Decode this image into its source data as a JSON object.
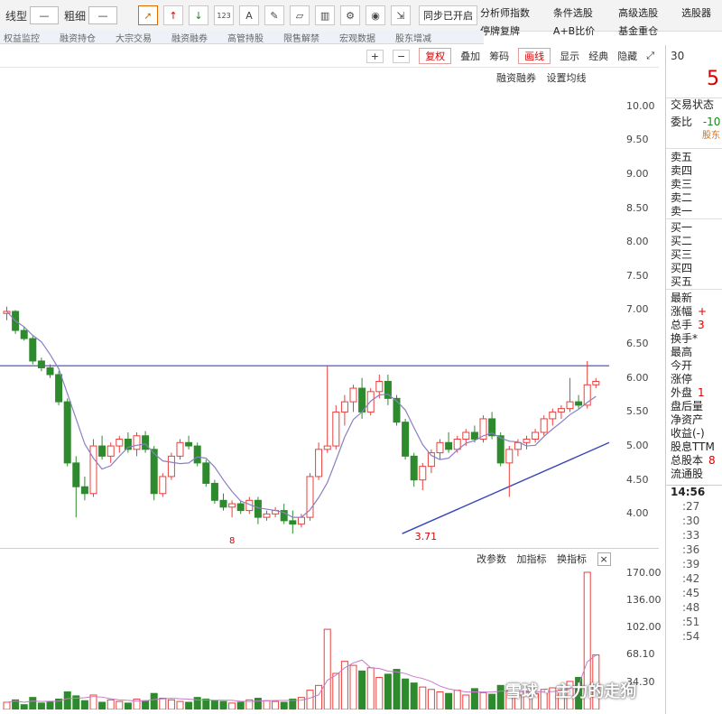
{
  "toolbar": {
    "line_type_label": "线型",
    "line_type_value": "—",
    "thickness_label": "粗细",
    "thickness_value": "—",
    "icon_names": [
      "cursor-icon",
      "up-arrow-icon",
      "down-arrow-icon",
      "number-icon",
      "text-icon",
      "pen-icon",
      "eraser-icon",
      "trash-icon",
      "settings-icon",
      "eye-icon",
      "export-icon"
    ],
    "number_icon_text": "123",
    "text_icon_text": "A",
    "sync_label": "同步已开启"
  },
  "top_menu": [
    "分析师指数",
    "条件选股",
    "高级选股",
    "选股器",
    "停牌复牌",
    "A+B比价",
    "基金重仓",
    ""
  ],
  "nav_tabs_cut": [
    "权益监控",
    "融资持仓",
    "大宗交易",
    "融资融券",
    "高管持股",
    "限售解禁",
    "宏观数据",
    "股东增减"
  ],
  "chart_toolbar": {
    "zoom_in": "+",
    "zoom_out": "−",
    "fuquan": "复权",
    "overlay": "叠加",
    "chip": "筹码",
    "draw": "画线",
    "display": "显示",
    "classic": "经典",
    "hide": "隐藏",
    "expand": "⤢"
  },
  "chart_subbar": {
    "margin": "融资融券",
    "ma_setting": "设置均线"
  },
  "price_axis": [
    "10.00",
    "9.50",
    "9.00",
    "8.50",
    "8.00",
    "7.50",
    "7.00",
    "6.50",
    "6.00",
    "5.50",
    "5.00",
    "4.50",
    "4.00"
  ],
  "low_marker": "3.71",
  "low_flag": "8",
  "volume_header": {
    "params": "改参数",
    "add": "加指标",
    "switch": "换指标"
  },
  "volume_axis": [
    "170.00",
    "136.00",
    "102.00",
    "68.10",
    "34.30"
  ],
  "right_panel": {
    "top_num": "30",
    "big_num": "5",
    "trade_status": "交易状态",
    "wei_bi_label": "委比",
    "wei_bi_val": "-10",
    "tag": "股东",
    "sell": [
      "卖五",
      "卖四",
      "卖三",
      "卖二",
      "卖一"
    ],
    "buy": [
      "买一",
      "买二",
      "买三",
      "买四",
      "买五"
    ],
    "stats": [
      "最新",
      "涨幅",
      "总手",
      "换手*",
      "最高",
      "今开",
      "涨停",
      "外盘",
      "盘后量",
      "净资产",
      "收益(-)",
      "股息TTM",
      "总股本",
      "流通股"
    ],
    "stat_vals": [
      "",
      "+",
      "3",
      "",
      "",
      "",
      "",
      "1",
      "",
      "",
      "",
      "",
      "8",
      ""
    ],
    "time": "14:56",
    "minutes": [
      ":27",
      ":30",
      ":33",
      ":36",
      ":39",
      ":42",
      ":45",
      ":48",
      ":51",
      ":54"
    ]
  },
  "watermark": "雪球 · 主力的走狗",
  "colors": {
    "up": "#e8403c",
    "down": "#2d8a2d",
    "ma": "#8a7fc4",
    "trend": "#3b46b8",
    "vol_ma": "#c77ac9"
  },
  "chart_data": {
    "type": "candlestick",
    "ylim": [
      3.5,
      10.3
    ],
    "resistance": 6.18,
    "support_start": [
      46,
      3.71
    ],
    "support_end": [
      104,
      5.05
    ],
    "candles": [
      [
        6.95,
        7.05,
        6.85,
        6.98
      ],
      [
        6.98,
        7.0,
        6.65,
        6.7
      ],
      [
        6.7,
        6.75,
        6.55,
        6.58
      ],
      [
        6.58,
        6.62,
        6.2,
        6.25
      ],
      [
        6.25,
        6.3,
        6.1,
        6.15
      ],
      [
        6.15,
        6.2,
        6.0,
        6.05
      ],
      [
        6.05,
        6.1,
        5.6,
        5.65
      ],
      [
        5.65,
        5.7,
        4.7,
        4.75
      ],
      [
        4.75,
        4.85,
        3.95,
        4.4
      ],
      [
        4.4,
        4.55,
        4.2,
        4.3
      ],
      [
        4.3,
        5.1,
        4.25,
        5.0
      ],
      [
        5.0,
        5.15,
        4.8,
        4.85
      ],
      [
        4.85,
        5.05,
        4.75,
        5.0
      ],
      [
        5.0,
        5.15,
        4.9,
        5.1
      ],
      [
        5.1,
        5.2,
        4.9,
        4.95
      ],
      [
        4.95,
        5.2,
        4.85,
        5.15
      ],
      [
        5.15,
        5.22,
        4.9,
        4.95
      ],
      [
        4.95,
        5.0,
        4.2,
        4.3
      ],
      [
        4.3,
        4.6,
        4.25,
        4.55
      ],
      [
        4.55,
        4.9,
        4.5,
        4.85
      ],
      [
        4.85,
        5.1,
        4.8,
        5.05
      ],
      [
        5.05,
        5.15,
        4.95,
        5.0
      ],
      [
        5.0,
        5.05,
        4.7,
        4.75
      ],
      [
        4.75,
        4.8,
        4.4,
        4.45
      ],
      [
        4.45,
        4.5,
        4.15,
        4.2
      ],
      [
        4.2,
        4.3,
        4.05,
        4.1
      ],
      [
        4.1,
        4.2,
        3.95,
        4.15
      ],
      [
        4.15,
        4.2,
        4.0,
        4.05
      ],
      [
        4.05,
        4.25,
        4.0,
        4.2
      ],
      [
        4.2,
        4.25,
        3.85,
        3.95
      ],
      [
        3.95,
        4.05,
        3.9,
        4.0
      ],
      [
        4.0,
        4.1,
        3.95,
        4.05
      ],
      [
        4.05,
        4.15,
        3.85,
        3.9
      ],
      [
        3.9,
        4.05,
        3.71,
        3.85
      ],
      [
        3.85,
        4.0,
        3.8,
        3.95
      ],
      [
        3.95,
        4.6,
        3.9,
        4.55
      ],
      [
        4.55,
        5.05,
        4.5,
        4.95
      ],
      [
        4.95,
        6.18,
        4.9,
        5.0
      ],
      [
        5.0,
        5.6,
        4.95,
        5.5
      ],
      [
        5.5,
        5.75,
        5.3,
        5.65
      ],
      [
        5.65,
        5.9,
        5.5,
        5.85
      ],
      [
        5.85,
        6.0,
        5.4,
        5.5
      ],
      [
        5.5,
        5.85,
        5.45,
        5.8
      ],
      [
        5.8,
        6.05,
        5.7,
        5.95
      ],
      [
        5.95,
        6.05,
        5.6,
        5.7
      ],
      [
        5.7,
        5.75,
        5.3,
        5.35
      ],
      [
        5.35,
        5.4,
        4.8,
        4.85
      ],
      [
        4.85,
        4.9,
        4.4,
        4.5
      ],
      [
        4.5,
        4.75,
        4.35,
        4.7
      ],
      [
        4.7,
        4.95,
        4.6,
        4.9
      ],
      [
        4.9,
        5.1,
        4.8,
        5.05
      ],
      [
        5.05,
        5.2,
        4.9,
        4.95
      ],
      [
        4.95,
        5.15,
        4.9,
        5.1
      ],
      [
        5.1,
        5.25,
        5.0,
        5.2
      ],
      [
        5.2,
        5.3,
        5.05,
        5.1
      ],
      [
        5.1,
        5.45,
        5.05,
        5.4
      ],
      [
        5.4,
        5.5,
        5.1,
        5.15
      ],
      [
        5.15,
        5.2,
        4.7,
        4.75
      ],
      [
        4.75,
        5.0,
        4.25,
        4.95
      ],
      [
        4.95,
        5.1,
        4.85,
        5.05
      ],
      [
        5.05,
        5.15,
        4.95,
        5.1
      ],
      [
        5.1,
        5.25,
        5.05,
        5.2
      ],
      [
        5.2,
        5.45,
        5.15,
        5.4
      ],
      [
        5.4,
        5.55,
        5.3,
        5.5
      ],
      [
        5.5,
        5.6,
        5.4,
        5.55
      ],
      [
        5.55,
        6.0,
        5.5,
        5.65
      ],
      [
        5.65,
        5.75,
        5.55,
        5.6
      ],
      [
        5.6,
        6.25,
        5.55,
        5.9
      ],
      [
        5.9,
        6.0,
        5.85,
        5.95
      ]
    ],
    "volumes": [
      9,
      12,
      6,
      15,
      8,
      10,
      13,
      22,
      17,
      11,
      18,
      9,
      12,
      10,
      8,
      13,
      11,
      20,
      14,
      12,
      10,
      9,
      15,
      13,
      11,
      10,
      8,
      9,
      12,
      14,
      11,
      10,
      9,
      13,
      15,
      24,
      30,
      100,
      45,
      60,
      55,
      48,
      52,
      40,
      44,
      50,
      38,
      33,
      28,
      25,
      22,
      20,
      24,
      18,
      26,
      21,
      19,
      30,
      23,
      18,
      22,
      20,
      25,
      27,
      24,
      35,
      40,
      171,
      68
    ],
    "volume_ylim": [
      0,
      180
    ]
  }
}
